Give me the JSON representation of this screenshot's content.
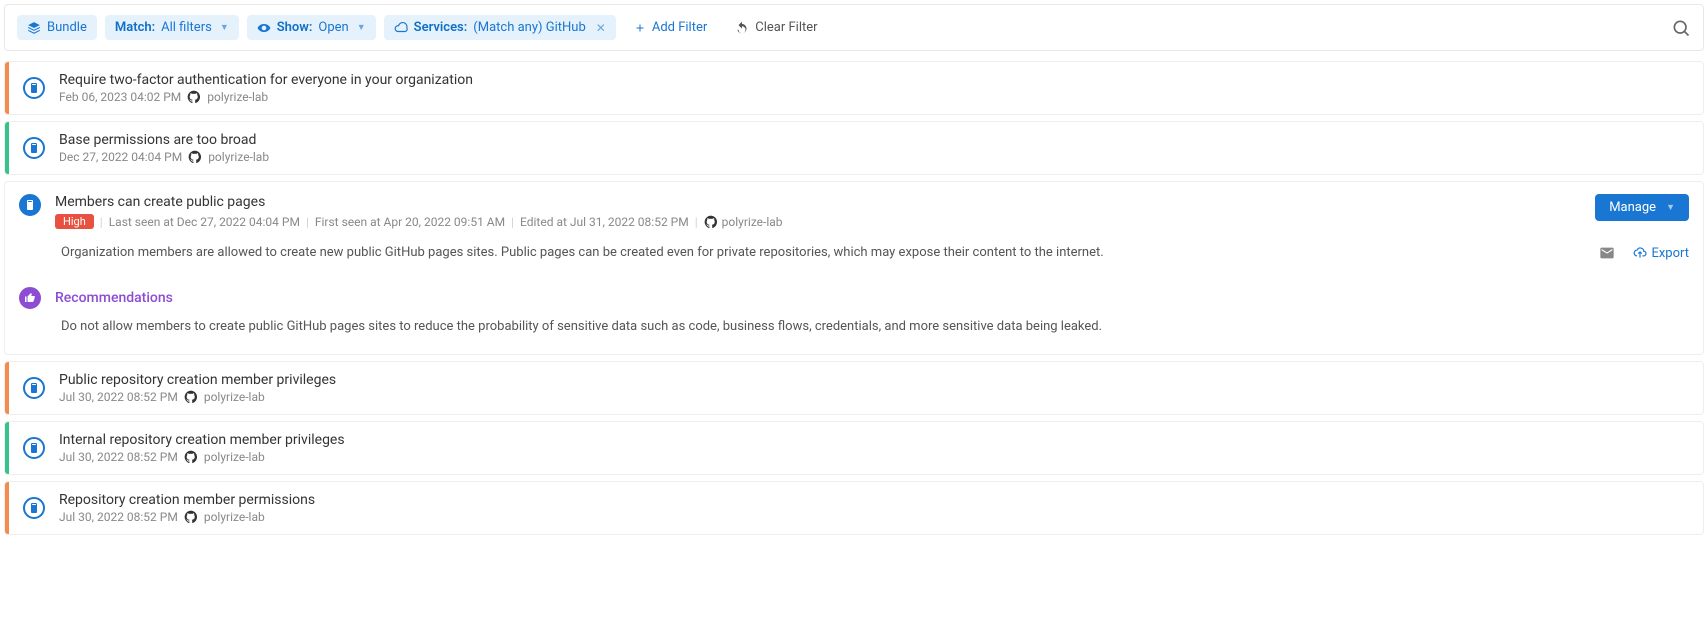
{
  "filters": {
    "bundle_label": "Bundle",
    "match_label": "Match:",
    "match_value": "All filters",
    "show_label": "Show:",
    "show_value": "Open",
    "services_label": "Services:",
    "services_value": "(Match any) GitHub",
    "add_filter_label": "Add Filter",
    "clear_filter_label": "Clear Filter"
  },
  "items": [
    {
      "title": "Require two-factor authentication for everyone in your organization",
      "date": "Feb 06, 2023 04:02 PM",
      "org": "polyrize-lab",
      "severity": "orange"
    },
    {
      "title": "Base permissions are too broad",
      "date": "Dec 27, 2022 04:04 PM",
      "org": "polyrize-lab",
      "severity": "green"
    }
  ],
  "expanded": {
    "title": "Members can create public pages",
    "badge": "High",
    "last_seen": "Last seen at Dec 27, 2022 04:04 PM",
    "first_seen": "First seen at Apr 20, 2022 09:51 AM",
    "edited": "Edited at Jul 31, 2022 08:52 PM",
    "org": "polyrize-lab",
    "manage_label": "Manage",
    "description": "Organization members are allowed to create new public GitHub pages sites. Public pages can be created even for private repositories, which may expose their content to the internet.",
    "export_label": "Export",
    "recommendations_label": "Recommendations",
    "recommendation_text": "Do not allow members to create public GitHub pages sites to reduce the probability of sensitive data such as code, business flows, credentials, and more sensitive data being leaked."
  },
  "items_after": [
    {
      "title": "Public repository creation member privileges",
      "date": "Jul 30, 2022 08:52 PM",
      "org": "polyrize-lab",
      "severity": "orange"
    },
    {
      "title": "Internal repository creation member privileges",
      "date": "Jul 30, 2022 08:52 PM",
      "org": "polyrize-lab",
      "severity": "green"
    },
    {
      "title": "Repository creation member permissions",
      "date": "Jul 30, 2022 08:52 PM",
      "org": "polyrize-lab",
      "severity": "orange"
    }
  ]
}
